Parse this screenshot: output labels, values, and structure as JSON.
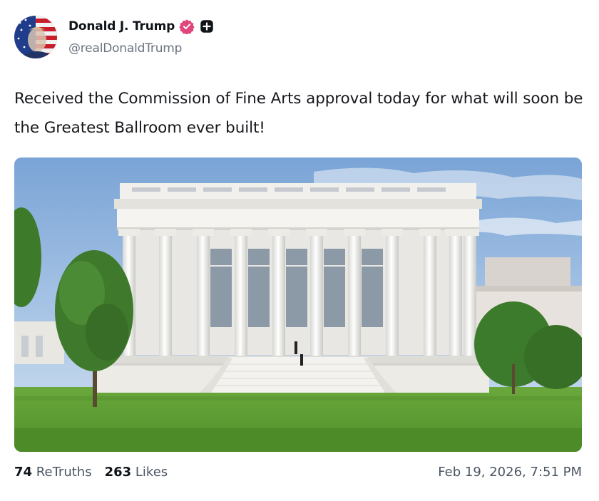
{
  "post": {
    "author": {
      "display_name": "Donald J. Trump",
      "handle": "@realDonaldTrump",
      "verified_badge_icon": "verified-badge-icon",
      "subscribe_icon": "plus-square-icon",
      "badge_color": "#e0457b"
    },
    "text": "Received the Commission of Fine Arts approval today for what will soon be the Greatest Ballroom ever built!",
    "image": {
      "subject": "building-rendering"
    },
    "stats": {
      "retruths_count": "74",
      "retruths_label": "ReTruths",
      "likes_count": "263",
      "likes_label": "Likes"
    },
    "timestamp": "Feb 19, 2026, 7:51 PM"
  }
}
